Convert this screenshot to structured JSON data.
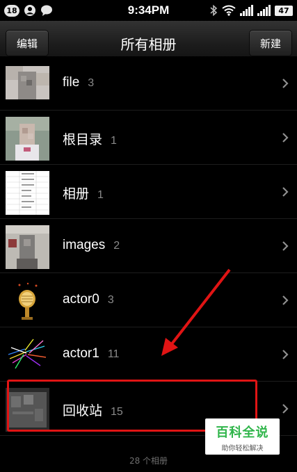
{
  "status_bar": {
    "notification_count": "18",
    "time": "9:34PM",
    "battery": "47",
    "icons": [
      "person-icon",
      "chat-bubble-icon",
      "bluetooth-icon",
      "wifi-icon",
      "signal-icon",
      "signal-icon"
    ]
  },
  "header": {
    "edit_label": "编辑",
    "title": "所有相册",
    "new_label": "新建"
  },
  "albums": [
    {
      "name": "file",
      "count": "3"
    },
    {
      "name": "根目录",
      "count": "1"
    },
    {
      "name": "相册",
      "count": "1"
    },
    {
      "name": "images",
      "count": "2"
    },
    {
      "name": "actor0",
      "count": "3"
    },
    {
      "name": "actor1",
      "count": "11"
    },
    {
      "name": "回收站",
      "count": "15"
    }
  ],
  "footer": {
    "album_count": "28 个相册"
  },
  "watermark": {
    "logo": "百科全说",
    "tagline": "助你轻松解决"
  },
  "colors": {
    "annotation_red": "#e01414",
    "brand_green": "#2fb54a"
  }
}
